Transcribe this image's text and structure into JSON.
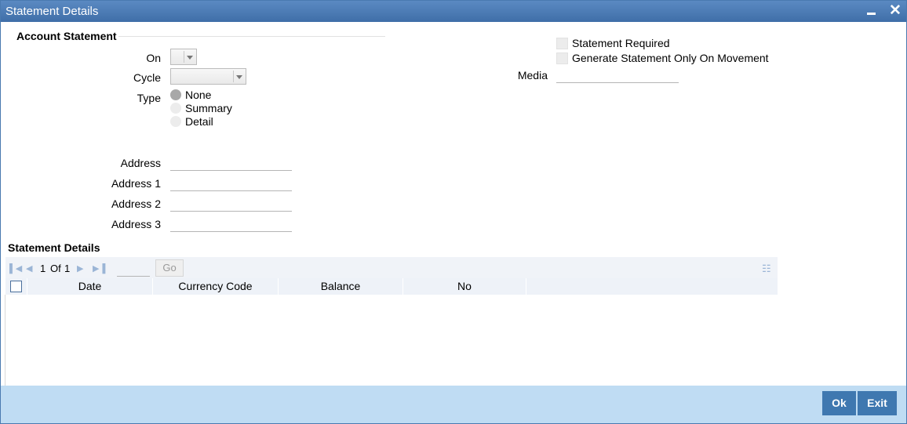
{
  "window": {
    "title": "Statement Details",
    "controls": {
      "minimize": "▬",
      "close": "✕"
    }
  },
  "account_statement": {
    "section_title": "Account Statement",
    "on_label": "On",
    "on_value": "",
    "cycle_label": "Cycle",
    "cycle_value": "",
    "type_label": "Type",
    "type_options": [
      "None",
      "Summary",
      "Detail"
    ],
    "type_selected": "None",
    "address_labels": [
      "Address",
      "Address 1",
      "Address 2",
      "Address 3"
    ],
    "address_values": [
      "",
      "",
      "",
      ""
    ],
    "statement_required_label": "Statement Required",
    "statement_required": false,
    "generate_on_movement_label": "Generate Statement Only On Movement",
    "generate_on_movement": false,
    "media_label": "Media",
    "media_value": ""
  },
  "statement_details": {
    "section_title": "Statement Details",
    "pager": {
      "current": "1",
      "of_label": "Of",
      "total": "1",
      "go_label": "Go",
      "page_input": ""
    },
    "columns": [
      "Date",
      "Currency Code",
      "Balance",
      "No"
    ],
    "rows": []
  },
  "footer": {
    "ok_label": "Ok",
    "exit_label": "Exit"
  },
  "colors": {
    "titlebar": "#4a7ab6",
    "footer": "#bfdcf3",
    "button": "#3f78b0"
  }
}
